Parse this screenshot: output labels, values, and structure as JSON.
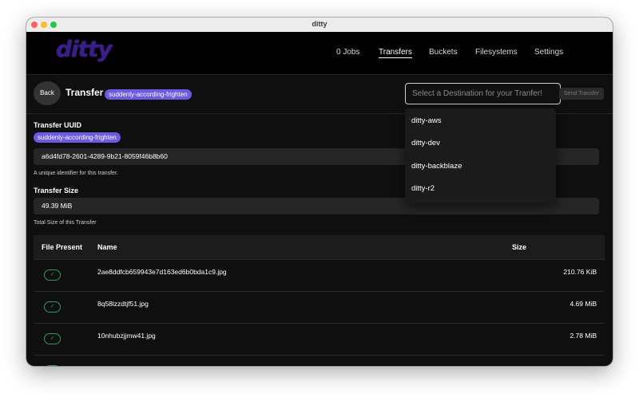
{
  "window": {
    "title": "ditty"
  },
  "app": {
    "logo_text": "ditty"
  },
  "nav": [
    {
      "label": "0 Jobs"
    },
    {
      "label": "Transfers",
      "active": true
    },
    {
      "label": "Buckets"
    },
    {
      "label": "Filesystems"
    },
    {
      "label": "Settings"
    }
  ],
  "header": {
    "back_label": "Back",
    "title": "Transfer",
    "badge": "suddenly-according-frighten",
    "destination_placeholder": "Select a Destination for your Tranfer!",
    "send_label": "Send Transfer"
  },
  "uuid": {
    "label": "Transfer UUID",
    "badge": "suddenly-according-frighten",
    "value": "a6d4fd78-2601-4289-9b21-8059f46b8b60",
    "help": "A unique identifier for this transfer."
  },
  "size": {
    "label": "Transfer Size",
    "value": "49.39 MiB",
    "help": "Total Size of this Transfer"
  },
  "table": {
    "headers": {
      "present": "File Present",
      "name": "Name",
      "size": "Size"
    },
    "check_glyph": "✓",
    "rows": [
      {
        "name": "2ae8ddfcb659943e7d163ed6b0bda1c9.jpg",
        "size": "210.76 KiB"
      },
      {
        "name": "8q58lzzdtjf51.jpg",
        "size": "4.69 MiB"
      },
      {
        "name": "10nhubzjjmw41.jpg",
        "size": "2.78 MiB"
      }
    ]
  },
  "dropdown": {
    "options": [
      "ditty-aws",
      "ditty-dev",
      "ditty-backblaze",
      "ditty-r2"
    ]
  },
  "colors": {
    "accent": "#6a5be0",
    "check": "#2e9a5e",
    "logo": "#3a1d8a"
  }
}
